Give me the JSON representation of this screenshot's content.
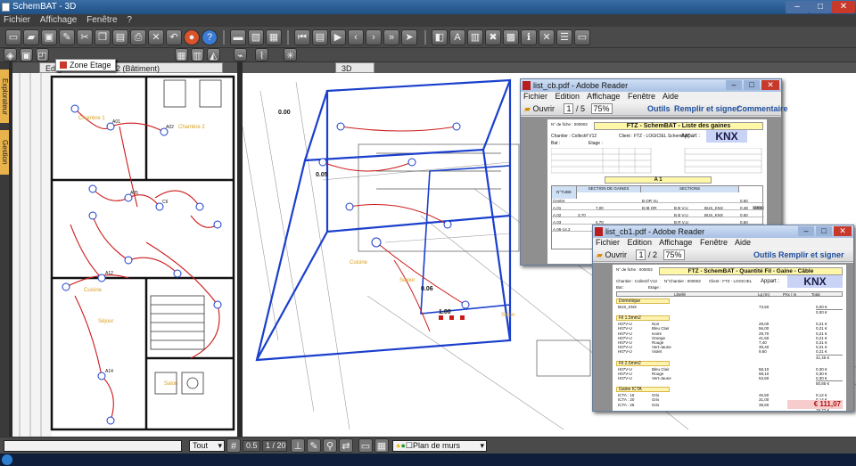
{
  "window": {
    "title": "SchemBAT - 3D",
    "buttons": [
      "–",
      "□",
      "✕"
    ]
  },
  "menu": {
    "items": [
      "Fichier",
      "Affichage",
      "Fenêtre",
      "?"
    ]
  },
  "tooltip": {
    "text": "Zone Etage"
  },
  "left_panel": {
    "tabs": [
      "Explorateur",
      "Gestion"
    ],
    "tab_title": "Ed          ge KNX Folio : 12 (Bâtiment)",
    "rooms": [
      "Chambre 1",
      "Chambre 2",
      "Cuisine",
      "Séjour",
      "Chambre 3",
      "Salon",
      "Dgt",
      "Sdb",
      "Pqt"
    ]
  },
  "right_panel": {
    "tab_title": "3D",
    "labels": [
      "0.00",
      "0.05",
      "0.06",
      "1.00",
      "Cuisine",
      "Séjour",
      "Salon"
    ]
  },
  "pdf1": {
    "title": "list_cb.pdf - Adobe Reader",
    "menu": [
      "Fichier",
      "Edition",
      "Affichage",
      "Fenêtre",
      "Aide"
    ],
    "toolbar": {
      "open": "Ouvrir",
      "page": "1",
      "page_total": "/ 5",
      "zoom": "75%",
      "tools": "Outils",
      "fill_sign": "Remplir et signer",
      "comment": "Commentaire"
    },
    "doc": {
      "title": "FTZ - SchemBAT - Liste des gaines",
      "doc_no": "N° de fiche : 000002",
      "chantier": "Chantier : Collectif V12",
      "client": "Client : FTZ - LOGICIEL SchemBAT",
      "appart": "Appart :",
      "badge": "KNX",
      "bat": "Bat :",
      "etage": "Etage :",
      "section": "A 1",
      "col_tube": "N°TUBE",
      "col_section": "SECTION DE GAINES",
      "col_sections": "SECTIONS",
      "rows": [
        [
          "Centre",
          "",
          "",
          "B OR Vu",
          "",
          "",
          "0.50",
          ""
        ],
        [
          "A.01",
          "",
          "7,00",
          "B IB OR",
          "B B V.U",
          "BUS_KNX",
          "0.48",
          "GRIS"
        ],
        [
          "A.02",
          "3,70",
          "",
          "",
          "B B V.U",
          "BUS_KNX",
          "0.50",
          ""
        ],
        [
          "A.03",
          "",
          "4,70",
          "",
          "B R V.U",
          "",
          "0.50",
          ""
        ],
        [
          "A.06-14.2",
          "",
          "3,00",
          "B IV",
          "B R V.U",
          "BUS_KNX",
          "0.48",
          "GRIS"
        ]
      ]
    }
  },
  "pdf2": {
    "title": "list_cb1.pdf - Adobe Reader",
    "menu": [
      "Fichier",
      "Edition",
      "Affichage",
      "Fenêtre",
      "Aide"
    ],
    "toolbar": {
      "open": "Ouvrir",
      "page": "1",
      "page_total": "/ 2",
      "zoom": "75%",
      "tools": "Outils",
      "fill_sign": "Remplir et signer",
      "comment": "Commentaire"
    },
    "doc": {
      "title": "FTZ - SchemBAT - Quantité Fil - Gaine - Câble",
      "doc_no": "N° de fiche : 000002",
      "chantier": "Chantier : Collectif V12",
      "chantier_no": "N°Chantier : 000002",
      "client": "Client : FTZ - LOGICIEL",
      "appart": "Appart :",
      "badge": "KNX",
      "bat": "Bat :",
      "etage": "Etage :",
      "columns": [
        "Libellé",
        "Lg (m)",
        "Prix / m",
        "Total"
      ],
      "groups": [
        {
          "name": "Domotique",
          "rows": [
            [
              "BUS_KNX",
              "",
              "73,50",
              "0,00 €"
            ]
          ],
          "sum": "0,00 €"
        },
        {
          "name": "Fil 1.5mm2",
          "rows": [
            [
              "H07V-U",
              "Noir",
              "28,00",
              "0,21 €"
            ],
            [
              "H07V-U",
              "Bleu Clair",
              "56,00",
              "0,21 €"
            ],
            [
              "H07V-U",
              "Ivoire",
              "29,70",
              "0,21 €"
            ],
            [
              "H07V-U",
              "Orange",
              "41,50",
              "0,21 €"
            ],
            [
              "H07V-U",
              "Rouge",
              "7,40",
              "0,21 €"
            ],
            [
              "H07V-U",
              "Vert-Jaune",
              "39,40",
              "0,21 €"
            ],
            [
              "H07V-U",
              "Violet",
              "9,60",
              "0,21 €"
            ]
          ],
          "sum": "41,45 €"
        },
        {
          "name": "Fil 2.5mm2",
          "rows": [
            [
              "H07V-U",
              "Bleu Clair",
              "58,10",
              "0,30 €"
            ],
            [
              "H07V-U",
              "Rouge",
              "58,10",
              "0,30 €"
            ],
            [
              "H07V-U",
              "Vert-Jaune",
              "53,60",
              "0,30 €"
            ]
          ],
          "sum": "50,85 €"
        },
        {
          "name": "Gaine ICTA",
          "rows": [
            [
              "ICTA : 16",
              "Gris",
              "46,50",
              "0,12 €"
            ],
            [
              "ICTA : 20",
              "Gris",
              "31,00",
              "0,14 €"
            ],
            [
              "ICTA : 25",
              "Gris",
              "38,60",
              "0,15 €"
            ]
          ],
          "sum": "18,77 €"
        }
      ],
      "grand_total": "€ 111,07"
    }
  },
  "bottom_bar": {
    "view_select": "Tout",
    "scale": "0.5",
    "ratio": "1 / 20",
    "layer_select": "Plan de murs"
  },
  "colors": {
    "accent": "#1a3fcc",
    "red": "#cc1a1a",
    "toolbar": "#4a4a4a"
  }
}
